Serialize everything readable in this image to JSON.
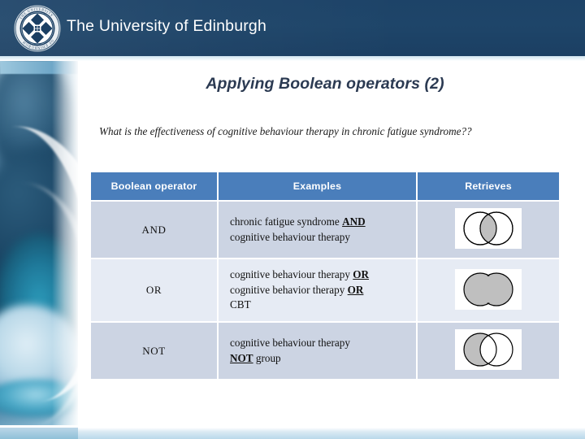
{
  "banner": {
    "institution": "The University of Edinburgh",
    "crest_icon": "university-crest-icon",
    "crest_motto_top": "THE UNIVERSITY",
    "crest_motto_bottom": "OF EDINBURGH"
  },
  "slide": {
    "title": "Applying Boolean operators (2)",
    "question": "What is the effectiveness of cognitive behaviour therapy in chronic fatigue syndrome??"
  },
  "table": {
    "headers": [
      "Boolean operator",
      "Examples",
      "Retrieves"
    ],
    "rows": [
      {
        "operator": "AND",
        "example_lines": [
          "chronic fatigue syndrome ",
          "AND",
          "cognitive behaviour therapy"
        ],
        "example_pre": "chronic fatigue syndrome ",
        "example_op": "AND",
        "example_post": "cognitive behaviour therapy",
        "venn": "venn-and-icon",
        "venn_desc": "two overlapping circles with intersection shaded"
      },
      {
        "operator": "OR",
        "example_line1_pre": "cognitive behaviour therapy ",
        "example_line1_op": "OR",
        "example_line2_pre": "cognitive behavior therapy ",
        "example_line2_op": "OR",
        "example_line3": "CBT",
        "venn": "venn-or-icon",
        "venn_desc": "two overlapping circles fully shaded (union)"
      },
      {
        "operator": "NOT",
        "example_pre": "cognitive behaviour therapy",
        "example_op": "NOT",
        "example_post": " group",
        "venn": "venn-not-icon",
        "venn_desc": "left circle shaded excluding overlap"
      }
    ]
  },
  "colors": {
    "banner_navy": "#1e4569",
    "header_blue": "#4a7ebb",
    "row_dark": "#ccd4e3",
    "row_light": "#e6ebf4",
    "title_navy": "#2b3a52",
    "venn_fill": "#c0c0c0"
  }
}
